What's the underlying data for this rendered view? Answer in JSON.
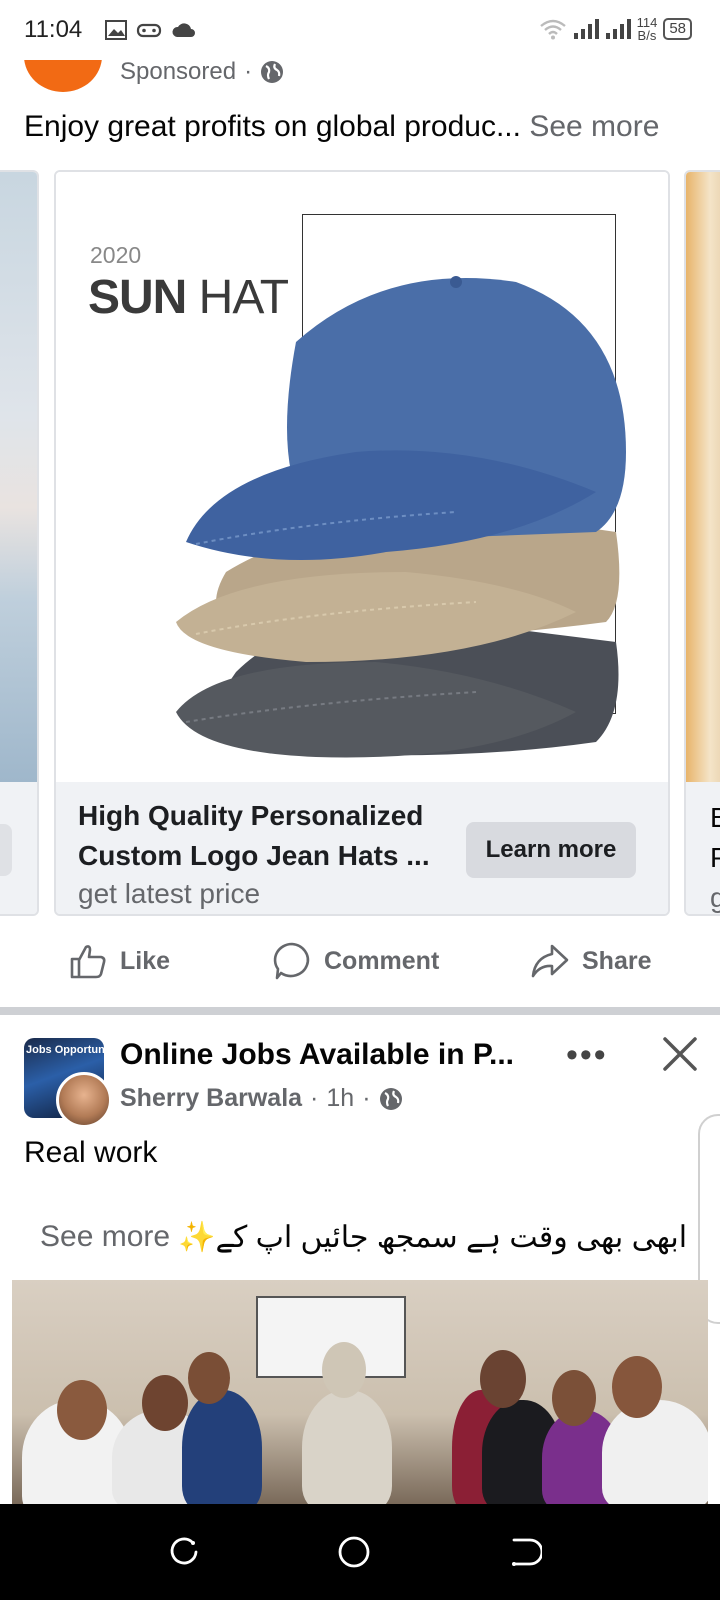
{
  "status_bar": {
    "time": "11:04",
    "net_speed_value": "114",
    "net_speed_unit": "B/s",
    "battery": "58",
    "icons": [
      "image-icon",
      "gamepad-icon",
      "cloud-icon",
      "wifi-icon",
      "signal-icon",
      "signal-icon"
    ]
  },
  "sponsored_post": {
    "label": "Sponsored",
    "separator": "·",
    "text": "Enjoy great profits on global produc...",
    "see_more": "See more",
    "carousel": {
      "main_card": {
        "image_year": "2020",
        "image_title_bold": "SUN",
        "image_title_rest": " HAT",
        "title": "High Quality Personalized Custom Logo Jean Hats ...",
        "subtitle": "get latest price",
        "button": "Learn more"
      },
      "right_card": {
        "line1": "B",
        "line2": "P",
        "line3": "g"
      }
    },
    "actions": {
      "like": "Like",
      "comment": "Comment",
      "share": "Share"
    }
  },
  "post": {
    "avatar_label": "Jobs Opportunity",
    "title": "Online Jobs Available in P...",
    "author": "Sherry Barwala",
    "time": "1h",
    "separator": "·",
    "more": "•••",
    "body_line": "Real work",
    "urdu_text": "✨ابھی بھی وقت ہے سمجھ جائیں اپ کے ...",
    "see_more": "See more"
  },
  "colors": {
    "secondary_text": "#65676b",
    "card_footer": "#f0f2f5",
    "accent_orange": "#f26a14"
  }
}
